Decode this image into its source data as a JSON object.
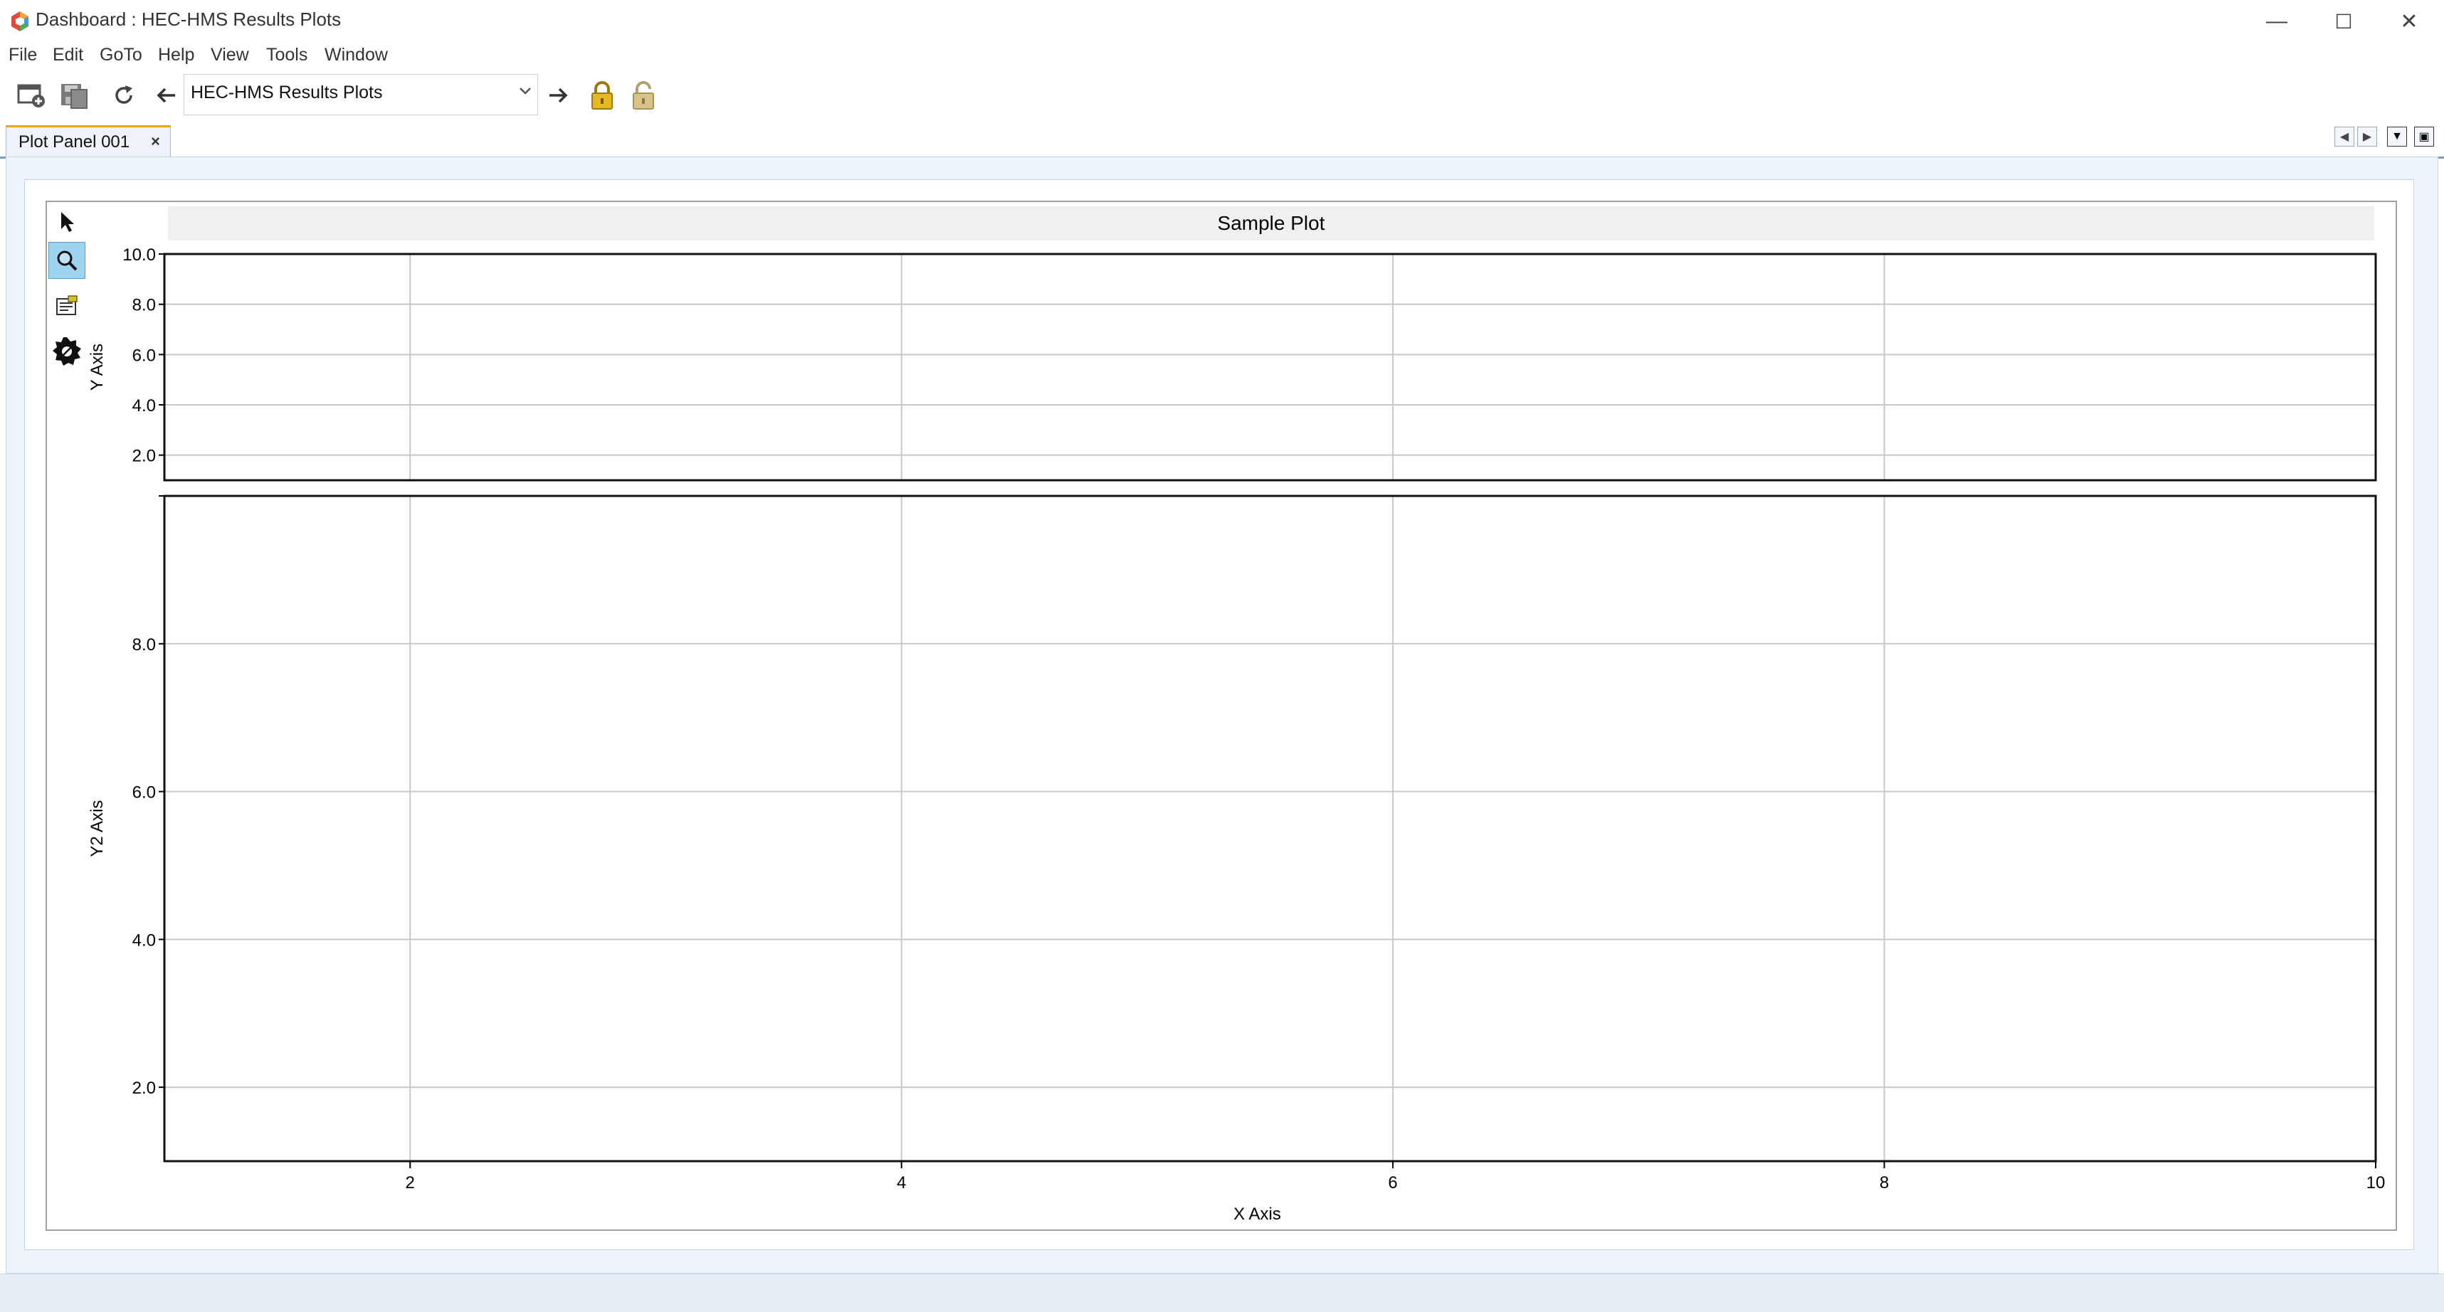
{
  "window": {
    "title": "Dashboard : HEC-HMS Results Plots",
    "controls": [
      "minimize",
      "maximize",
      "close"
    ]
  },
  "menu": {
    "items": [
      "File",
      "Edit",
      "GoTo",
      "Help",
      "View",
      "Tools",
      "Window"
    ]
  },
  "toolbar": {
    "buttons": [
      "new-dashboard-icon",
      "save-icon",
      "refresh-icon",
      "back-arrow-icon",
      "forward-arrow-icon",
      "lock-icon",
      "unlock-icon"
    ],
    "dashboard_select": "HEC-HMS Results Plots"
  },
  "tabs": [
    {
      "label": "Plot Panel 001",
      "close": "×"
    }
  ],
  "plot_tools": [
    "pointer-icon",
    "zoom-icon",
    "properties-icon",
    "settings-gear-icon"
  ],
  "accent": {
    "tab_highlight": "#f0a500",
    "zoom_active": "#9fd4f0"
  },
  "chart_data": [
    {
      "type": "line",
      "title": "Sample Plot",
      "xlabel": "",
      "ylabel": "Y Axis",
      "xlim": [
        1,
        10
      ],
      "ylim": [
        1,
        10
      ],
      "yticks": [
        "2.0",
        "4.0",
        "6.0",
        "8.0",
        "10.0"
      ],
      "grid": true,
      "series": []
    },
    {
      "type": "line",
      "title": "",
      "xlabel": "X Axis",
      "ylabel": "Y2 Axis",
      "xlim": [
        1,
        10
      ],
      "ylim": [
        1,
        10
      ],
      "xticks": [
        "2",
        "4",
        "6",
        "8",
        "10"
      ],
      "yticks": [
        "2.0",
        "4.0",
        "6.0",
        "8.0"
      ],
      "grid": true,
      "series": []
    }
  ]
}
